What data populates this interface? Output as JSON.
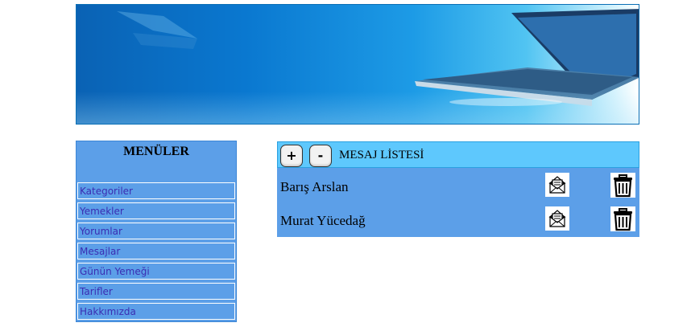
{
  "sidebar": {
    "title": "MENÜLER",
    "items": [
      {
        "label": "Kategoriler"
      },
      {
        "label": "Yemekler"
      },
      {
        "label": "Yorumlar"
      },
      {
        "label": "Mesajlar"
      },
      {
        "label": "Günün Yemeği"
      },
      {
        "label": "Tarifler"
      },
      {
        "label": "Hakkımızda"
      }
    ]
  },
  "messages": {
    "title": "MESAJ LİSTESİ",
    "add_label": "+",
    "remove_label": "-",
    "rows": [
      {
        "sender": "Barış Arslan",
        "read_icon": "open-envelope-icon",
        "delete_icon": "trash-icon"
      },
      {
        "sender": "Murat Yücedağ",
        "read_icon": "open-envelope-icon",
        "delete_icon": "trash-icon"
      }
    ]
  },
  "banner": {
    "image": "laptop-banner"
  },
  "colors": {
    "sidebar_bg": "#5c9fe8",
    "header_bg": "#5ec8fd",
    "menu_text": "#3b2db2"
  }
}
